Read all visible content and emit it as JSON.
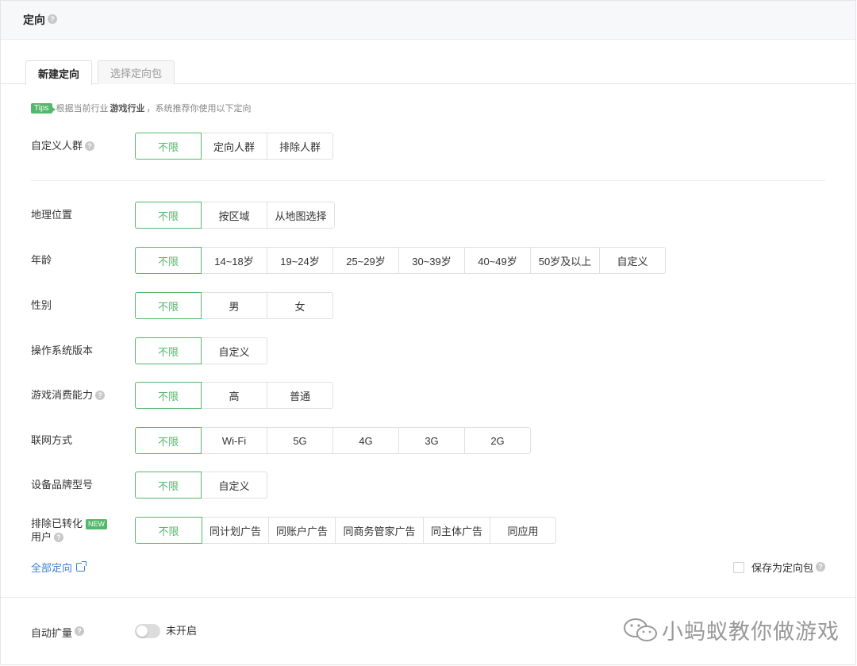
{
  "header": {
    "title": "定向",
    "help": "?"
  },
  "tabs": [
    {
      "label": "新建定向",
      "active": true
    },
    {
      "label": "选择定向包",
      "active": false
    }
  ],
  "tips": {
    "badge": "Tips",
    "prefix": "根据当前行业",
    "industry": "游戏行业",
    "suffix": "，系统推荐你使用以下定向"
  },
  "rows": {
    "custom_audience": {
      "label": "自定义人群",
      "options": [
        "不限",
        "定向人群",
        "排除人群"
      ]
    },
    "location": {
      "label": "地理位置",
      "options": [
        "不限",
        "按区域",
        "从地图选择"
      ]
    },
    "age": {
      "label": "年龄",
      "options": [
        "不限",
        "14~18岁",
        "19~24岁",
        "25~29岁",
        "30~39岁",
        "40~49岁",
        "50岁及以上",
        "自定义"
      ]
    },
    "gender": {
      "label": "性别",
      "options": [
        "不限",
        "男",
        "女"
      ]
    },
    "os_version": {
      "label": "操作系统版本",
      "options": [
        "不限",
        "自定义"
      ]
    },
    "game_spending": {
      "label": "游戏消费能力",
      "options": [
        "不限",
        "高",
        "普通"
      ]
    },
    "network": {
      "label": "联网方式",
      "options": [
        "不限",
        "Wi-Fi",
        "5G",
        "4G",
        "3G",
        "2G"
      ]
    },
    "device_brand": {
      "label": "设备品牌型号",
      "options": [
        "不限",
        "自定义"
      ]
    },
    "exclude_converted": {
      "label_line1": "排除已转化",
      "label_line2": "用户",
      "badge": "NEW",
      "options": [
        "不限",
        "同计划广告",
        "同账户广告",
        "同商务管家广告",
        "同主体广告",
        "同应用"
      ]
    }
  },
  "footer": {
    "all_targeting": "全部定向",
    "save_as_pack": "保存为定向包"
  },
  "auto_expand": {
    "label": "自动扩量",
    "state_text": "未开启",
    "enabled": false
  },
  "watermark": {
    "text": "小蚂蚁教你做游戏"
  },
  "colors": {
    "accent": "#52b86a",
    "link": "#3b7fd6"
  }
}
